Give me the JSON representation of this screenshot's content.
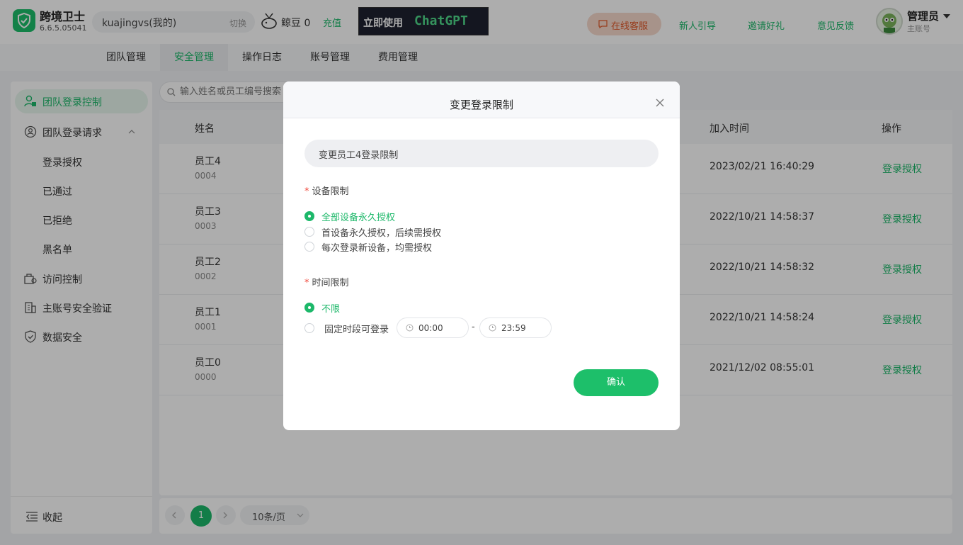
{
  "app": {
    "name": "跨境卫士",
    "version": "6.6.5.05041"
  },
  "account": {
    "name": "kuajingvs(我的)",
    "switch_label": "切换"
  },
  "beans": {
    "label": "鲸豆 0",
    "recharge_label": "充值"
  },
  "banner": {
    "text_a": "立即使用",
    "text_b": "ChatGPT"
  },
  "header_links": {
    "service": "在线客服",
    "guide": "新人引导",
    "invite": "邀请好礼",
    "feedback": "意见反馈"
  },
  "user": {
    "name": "管理员",
    "role": "主账号"
  },
  "tabs": [
    {
      "label": "团队管理"
    },
    {
      "label": "安全管理"
    },
    {
      "label": "操作日志"
    },
    {
      "label": "账号管理"
    },
    {
      "label": "费用管理"
    }
  ],
  "active_tab": "安全管理",
  "sidebar": {
    "items": [
      {
        "label": "团队登录控制",
        "icon": "user-lock-icon"
      },
      {
        "label": "团队登录请求",
        "icon": "request-icon"
      },
      {
        "label": "登录授权"
      },
      {
        "label": "已通过"
      },
      {
        "label": "已拒绝"
      },
      {
        "label": "黑名单"
      },
      {
        "label": "访问控制",
        "icon": "access-icon"
      },
      {
        "label": "主账号安全验证",
        "icon": "building-icon"
      },
      {
        "label": "数据安全",
        "icon": "shield-icon"
      }
    ],
    "collapse_label": "收起"
  },
  "search": {
    "placeholder": "输入姓名或员工编号搜索"
  },
  "table": {
    "columns": {
      "name": "姓名",
      "join_time": "加入时间",
      "action": "操作"
    },
    "rows": [
      {
        "name": "员工4",
        "id": "0004",
        "join_time": "2023/02/21 16:40:29",
        "action": "登录授权"
      },
      {
        "name": "员工3",
        "id": "0003",
        "join_time": "2022/10/21 14:58:37",
        "action": "登录授权"
      },
      {
        "name": "员工2",
        "id": "0002",
        "join_time": "2022/10/21 14:58:32",
        "action": "登录授权"
      },
      {
        "name": "员工1",
        "id": "0001",
        "join_time": "2022/10/21 14:58:24",
        "action": "登录授权"
      },
      {
        "name": "员工0",
        "id": "0000",
        "join_time": "2021/12/02 08:55:01",
        "action": "登录授权"
      }
    ]
  },
  "pagination": {
    "current_page": "1",
    "page_size": "10条/页"
  },
  "modal": {
    "title": "变更登录限制",
    "target": "变更员工4登录限制",
    "device_section": "设备限制",
    "device_options": [
      {
        "label": "全部设备永久授权",
        "selected": true
      },
      {
        "label": "首设备永久授权，后续需授权",
        "selected": false
      },
      {
        "label": "每次登录新设备，均需授权",
        "selected": false
      }
    ],
    "time_section": "时间限制",
    "time_options": [
      {
        "label": "不限",
        "selected": true
      },
      {
        "label": "固定时段可登录",
        "selected": false
      }
    ],
    "time_start": "00:00",
    "time_separator": "-",
    "time_end": "23:59",
    "required_mark": "*",
    "confirm_label": "确认"
  },
  "colors": {
    "accent": "#1db86a",
    "danger": "#f04a3e",
    "service": "#e05a2b"
  }
}
